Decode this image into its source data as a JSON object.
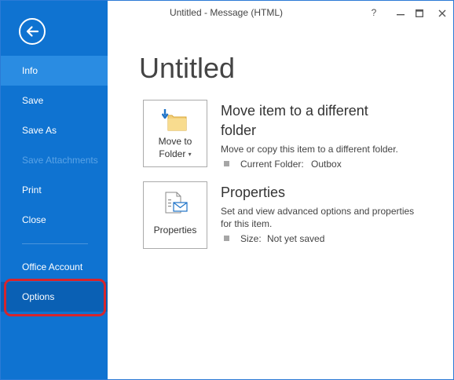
{
  "window": {
    "title": "Untitled - Message (HTML)",
    "controls": {
      "help": "?",
      "restore_glyph": "▭",
      "close_glyph": "✕"
    }
  },
  "sidebar": {
    "items": [
      {
        "label": "Info",
        "state": "selected"
      },
      {
        "label": "Save",
        "state": "normal"
      },
      {
        "label": "Save As",
        "state": "normal"
      },
      {
        "label": "Save Attachments",
        "state": "disabled"
      },
      {
        "label": "Print",
        "state": "normal"
      },
      {
        "label": "Close",
        "state": "normal"
      },
      {
        "label": "Office Account",
        "state": "normal"
      },
      {
        "label": "Options",
        "state": "hovered"
      }
    ]
  },
  "main": {
    "page_title": "Untitled",
    "move": {
      "button_line1": "Move to",
      "button_line2": "Folder",
      "heading_line1": "Move item to a different",
      "heading_line2": "folder",
      "description": "Move or copy this item to a different folder.",
      "prop_label": "Current Folder:",
      "prop_value": "Outbox"
    },
    "properties": {
      "button_label": "Properties",
      "heading": "Properties",
      "description_line1": "Set and view advanced options and properties",
      "description_line2": "for this item.",
      "prop_label": "Size:",
      "prop_value": "Not yet saved"
    }
  },
  "colors": {
    "sidebar_bg": "#0f73d1",
    "sidebar_selected": "#2a8ce2",
    "sidebar_hover": "#0a60b4",
    "highlight_ring": "#d6252c"
  }
}
